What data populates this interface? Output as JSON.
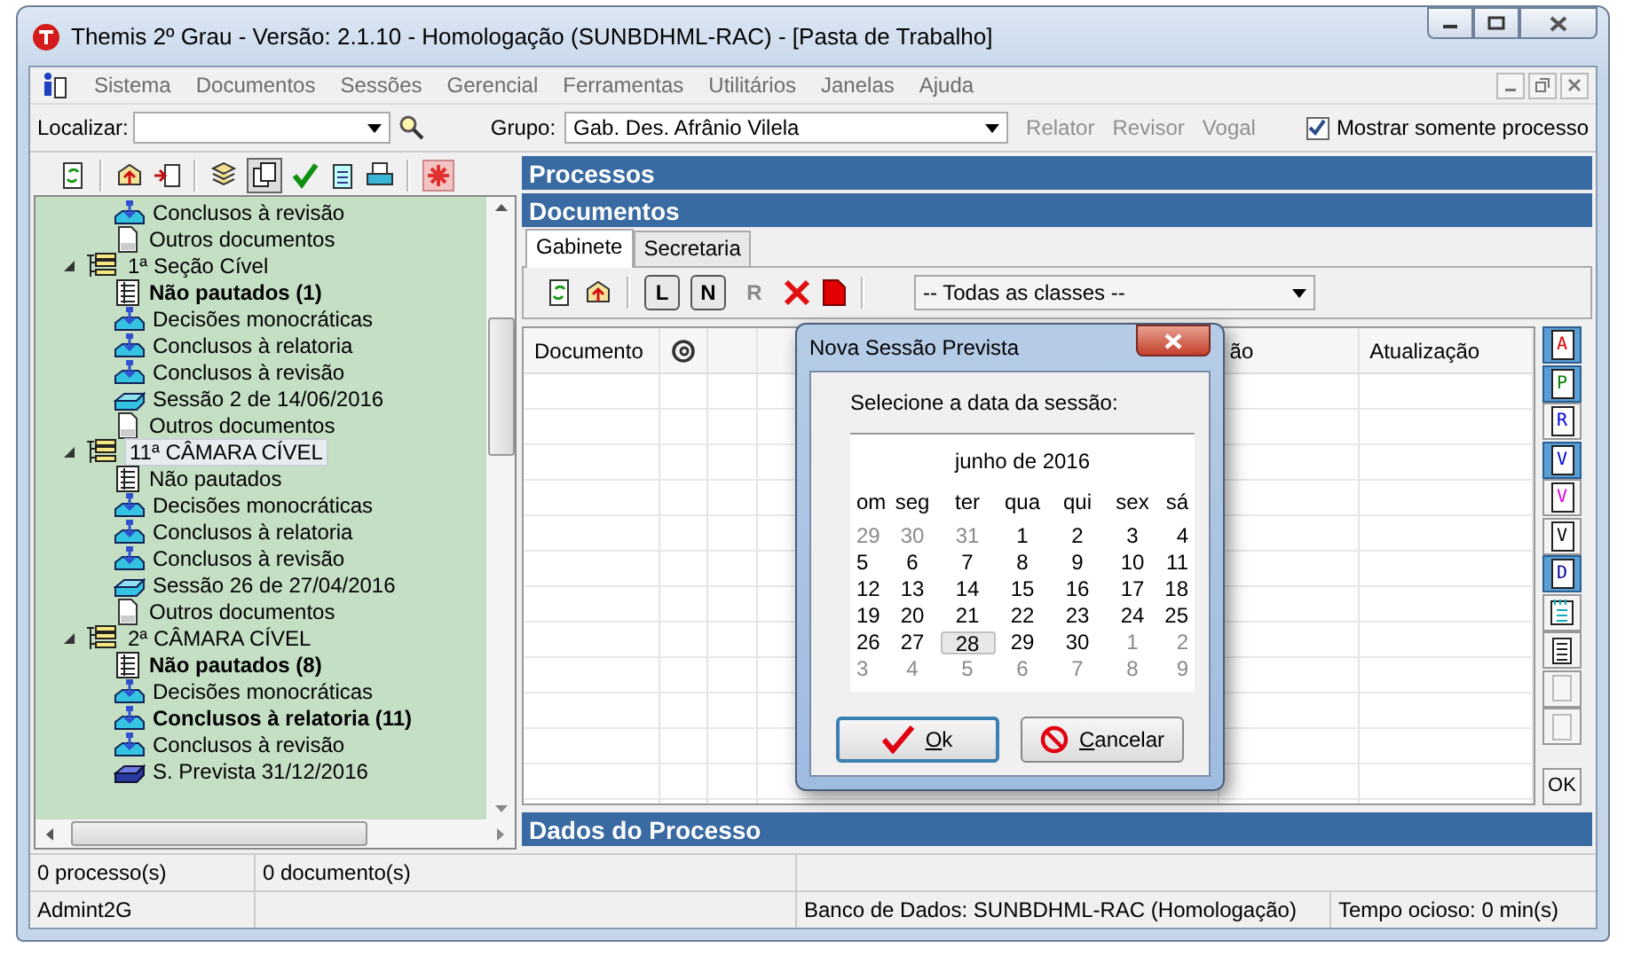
{
  "window": {
    "title": "Themis 2º Grau - Versão: 2.1.10 - Homologação (SUNBDHML-RAC) - [Pasta de Trabalho]"
  },
  "menu": [
    "Sistema",
    "Documentos",
    "Sessões",
    "Gerencial",
    "Ferramentas",
    "Utilitários",
    "Janelas",
    "Ajuda"
  ],
  "toolbar": {
    "search_label": "Localizar:",
    "group_label": "Grupo:",
    "group_value": "Gab. Des. Afrânio Vilela",
    "roles": [
      {
        "label": "Relator",
        "disabled": true
      },
      {
        "label": "Revisor",
        "disabled": true
      },
      {
        "label": "Vogal",
        "disabled": true
      }
    ],
    "only_mine": {
      "label": "Mostrar somente processo",
      "checked": true
    }
  },
  "tree": [
    {
      "children": [
        {
          "kind": "tray",
          "label": "Conclusos à revisão",
          "bold": false
        },
        {
          "kind": "doc",
          "label": "Outros documentos",
          "bold": false
        }
      ]
    },
    {
      "label": "1ª Seção Cível",
      "expanded": true,
      "selected": false,
      "children": [
        {
          "kind": "list",
          "label": "Não pautados (1)",
          "bold": true
        },
        {
          "kind": "tray",
          "label": "Decisões monocráticas",
          "bold": false
        },
        {
          "kind": "tray",
          "label": "Conclusos à relatoria",
          "bold": false
        },
        {
          "kind": "tray",
          "label": "Conclusos à revisão",
          "bold": false
        },
        {
          "kind": "session",
          "label": "Sessão 2 de 14/06/2016",
          "bold": false
        },
        {
          "kind": "doc",
          "label": "Outros documentos",
          "bold": false
        }
      ]
    },
    {
      "label": "11ª CÂMARA CÍVEL",
      "expanded": true,
      "selected": true,
      "children": [
        {
          "kind": "list",
          "label": "Não pautados",
          "bold": false
        },
        {
          "kind": "tray",
          "label": "Decisões monocráticas",
          "bold": false
        },
        {
          "kind": "tray",
          "label": "Conclusos à relatoria",
          "bold": false
        },
        {
          "kind": "tray",
          "label": "Conclusos à revisão",
          "bold": false
        },
        {
          "kind": "session",
          "label": "Sessão 26 de 27/04/2016",
          "bold": false
        },
        {
          "kind": "doc",
          "label": "Outros documentos",
          "bold": false
        }
      ]
    },
    {
      "label": "2ª CÂMARA CÍVEL",
      "expanded": true,
      "selected": false,
      "children": [
        {
          "kind": "list",
          "label": "Não pautados (8)",
          "bold": true
        },
        {
          "kind": "tray",
          "label": "Decisões monocráticas",
          "bold": false
        },
        {
          "kind": "tray",
          "label": "Conclusos à relatoria (11)",
          "bold": true
        },
        {
          "kind": "tray",
          "label": "Conclusos à revisão",
          "bold": false
        },
        {
          "kind": "planned",
          "label": "S. Prevista 31/12/2016",
          "bold": false
        }
      ]
    }
  ],
  "panels": {
    "processes": "Processos",
    "documents": "Documentos",
    "details": "Dados do Processo"
  },
  "tabs": [
    {
      "label": "Gabinete",
      "selected": true
    },
    {
      "label": "Secretaria",
      "selected": false
    }
  ],
  "doc_toolbar": {
    "toggles": [
      {
        "label": "L",
        "pressed": true,
        "disabled": false
      },
      {
        "label": "N",
        "pressed": true,
        "disabled": false
      },
      {
        "label": "R",
        "pressed": false,
        "disabled": true
      }
    ],
    "class_filter": "-- Todas as classes --"
  },
  "grid": {
    "columns": [
      "Documento",
      "ão",
      "Atualização"
    ]
  },
  "side_buttons": [
    {
      "kind": "letter",
      "label": "A",
      "color": "#e00000",
      "pressed": true
    },
    {
      "kind": "letter",
      "label": "P",
      "color": "#008000",
      "pressed": true
    },
    {
      "kind": "letter",
      "label": "R",
      "color": "#0000e0",
      "pressed": false
    },
    {
      "kind": "letter",
      "label": "V",
      "color": "#0000e0",
      "pressed": true
    },
    {
      "kind": "letter",
      "label": "V",
      "color": "#e000e0",
      "pressed": false
    },
    {
      "kind": "letter",
      "label": "V",
      "color": "#000000",
      "pressed": false
    },
    {
      "kind": "letter",
      "label": "D",
      "color": "#0000a0",
      "pressed": true
    },
    {
      "kind": "notepad",
      "pressed": false
    },
    {
      "kind": "page",
      "pressed": false
    },
    {
      "kind": "blank",
      "pressed": false
    },
    {
      "kind": "blank",
      "pressed": false
    },
    {
      "kind": "text",
      "label": "OK",
      "pressed": false
    }
  ],
  "dialog": {
    "title": "Nova Sessão Prevista",
    "prompt": "Selecione a data da sessão:",
    "month": "junho de 2016",
    "weekdays": [
      "om",
      "seg",
      "ter",
      "qua",
      "qui",
      "sex",
      "sá"
    ],
    "weeks": [
      [
        {
          "day": "29",
          "other_month": true,
          "selected": false
        },
        {
          "day": "30",
          "other_month": true,
          "selected": false
        },
        {
          "day": "31",
          "other_month": true,
          "selected": false
        },
        {
          "day": "1",
          "other_month": false,
          "selected": false
        },
        {
          "day": "2",
          "other_month": false,
          "selected": false
        },
        {
          "day": "3",
          "other_month": false,
          "selected": false
        },
        {
          "day": "4",
          "other_month": false,
          "selected": false
        }
      ],
      [
        {
          "day": "5",
          "other_month": false,
          "selected": false
        },
        {
          "day": "6",
          "other_month": false,
          "selected": false
        },
        {
          "day": "7",
          "other_month": false,
          "selected": false
        },
        {
          "day": "8",
          "other_month": false,
          "selected": false
        },
        {
          "day": "9",
          "other_month": false,
          "selected": false
        },
        {
          "day": "10",
          "other_month": false,
          "selected": false
        },
        {
          "day": "11",
          "other_month": false,
          "selected": false
        }
      ],
      [
        {
          "day": "12",
          "other_month": false,
          "selected": false
        },
        {
          "day": "13",
          "other_month": false,
          "selected": false
        },
        {
          "day": "14",
          "other_month": false,
          "selected": false
        },
        {
          "day": "15",
          "other_month": false,
          "selected": false
        },
        {
          "day": "16",
          "other_month": false,
          "selected": false
        },
        {
          "day": "17",
          "other_month": false,
          "selected": false
        },
        {
          "day": "18",
          "other_month": false,
          "selected": false
        }
      ],
      [
        {
          "day": "19",
          "other_month": false,
          "selected": false
        },
        {
          "day": "20",
          "other_month": false,
          "selected": false
        },
        {
          "day": "21",
          "other_month": false,
          "selected": false
        },
        {
          "day": "22",
          "other_month": false,
          "selected": false
        },
        {
          "day": "23",
          "other_month": false,
          "selected": false
        },
        {
          "day": "24",
          "other_month": false,
          "selected": false
        },
        {
          "day": "25",
          "other_month": false,
          "selected": false
        }
      ],
      [
        {
          "day": "26",
          "other_month": false,
          "selected": false
        },
        {
          "day": "27",
          "other_month": false,
          "selected": false
        },
        {
          "day": "28",
          "other_month": false,
          "selected": true
        },
        {
          "day": "29",
          "other_month": false,
          "selected": false
        },
        {
          "day": "30",
          "other_month": false,
          "selected": false
        },
        {
          "day": "1",
          "other_month": true,
          "selected": false
        },
        {
          "day": "2",
          "other_month": true,
          "selected": false
        }
      ],
      [
        {
          "day": "3",
          "other_month": true,
          "selected": false
        },
        {
          "day": "4",
          "other_month": true,
          "selected": false
        },
        {
          "day": "5",
          "other_month": true,
          "selected": false
        },
        {
          "day": "6",
          "other_month": true,
          "selected": false
        },
        {
          "day": "7",
          "other_month": true,
          "selected": false
        },
        {
          "day": "8",
          "other_month": true,
          "selected": false
        },
        {
          "day": "9",
          "other_month": true,
          "selected": false
        }
      ]
    ],
    "buttons": [
      {
        "kind": "ok",
        "label": "Ok",
        "focused": true
      },
      {
        "kind": "cancel",
        "label": "Cancelar",
        "focused": false
      }
    ]
  },
  "status": {
    "counts": [
      "0 processo(s)",
      "0 documento(s)"
    ],
    "user": "Admint2G",
    "database": "Banco de Dados: SUNBDHML-RAC (Homologação)",
    "idle": "Tempo ocioso: 0 min(s)"
  }
}
